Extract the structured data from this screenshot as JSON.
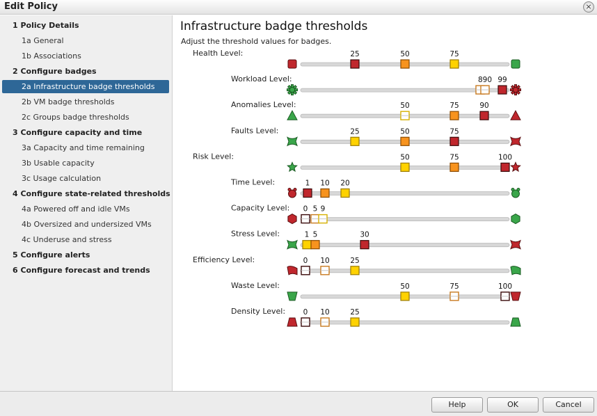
{
  "window": {
    "title": "Edit Policy"
  },
  "nav": [
    {
      "label": "1 Policy Details",
      "type": "section"
    },
    {
      "label": "1a General",
      "type": "sub"
    },
    {
      "label": "1b Associations",
      "type": "sub"
    },
    {
      "label": "2 Configure badges",
      "type": "section"
    },
    {
      "label": "2a Infrastructure badge thresholds",
      "type": "sub",
      "selected": true
    },
    {
      "label": "2b VM badge thresholds",
      "type": "sub"
    },
    {
      "label": "2c Groups badge thresholds",
      "type": "sub"
    },
    {
      "label": "3 Configure capacity and time",
      "type": "section"
    },
    {
      "label": "3a Capacity and time remaining",
      "type": "sub"
    },
    {
      "label": "3b Usable capacity",
      "type": "sub"
    },
    {
      "label": "3c Usage calculation",
      "type": "sub"
    },
    {
      "label": "4 Configure state-related thresholds",
      "type": "section"
    },
    {
      "label": "4a Powered off and idle VMs",
      "type": "sub"
    },
    {
      "label": "4b Oversized and undersized VMs",
      "type": "sub"
    },
    {
      "label": "4c Underuse and stress",
      "type": "sub"
    },
    {
      "label": "5 Configure alerts",
      "type": "section"
    },
    {
      "label": "6 Configure forecast and trends",
      "type": "section"
    }
  ],
  "main": {
    "title": "Infrastructure badge thresholds",
    "description": "Adjust the threshold values for badges."
  },
  "colors": {
    "red": "#c0272d",
    "orange": "#f7931e",
    "yellow": "#ffd200",
    "green": "#3aa64a",
    "selected_nav": "#2e6797",
    "track": "#d8d8d8"
  },
  "thresholds": [
    {
      "label": "Health Level:",
      "level": 0,
      "left_icon": "red-square-icon",
      "right_icon": "green-square-icon",
      "handles": [
        {
          "value": "25",
          "color": "red"
        },
        {
          "value": "50",
          "color": "orange"
        },
        {
          "value": "75",
          "color": "yellow"
        }
      ]
    },
    {
      "label": "Workload Level:",
      "level": 1,
      "left_icon": "green-gear-icon",
      "right_icon": "red-gear-icon",
      "handles": [
        {
          "value": "",
          "color": "disabled-orange"
        },
        {
          "value": "890",
          "color": "disabled-orange"
        },
        {
          "value": "99",
          "color": "red"
        }
      ]
    },
    {
      "label": "Anomalies Level:",
      "level": 1,
      "left_icon": "green-triangle-icon",
      "right_icon": "red-triangle-icon",
      "handles": [
        {
          "value": "50",
          "color": "disabled-yellow"
        },
        {
          "value": "75",
          "color": "orange"
        },
        {
          "value": "90",
          "color": "red"
        }
      ]
    },
    {
      "label": "Faults Level:",
      "level": 1,
      "left_icon": "green-bowtie-icon",
      "right_icon": "red-bowtie-icon",
      "handles": [
        {
          "value": "25",
          "color": "yellow"
        },
        {
          "value": "50",
          "color": "orange"
        },
        {
          "value": "75",
          "color": "red"
        }
      ]
    },
    {
      "label": "Risk Level:",
      "level": 0,
      "left_icon": "green-star-icon",
      "right_icon": "red-star-icon",
      "handles": [
        {
          "value": "50",
          "color": "yellow"
        },
        {
          "value": "75",
          "color": "orange"
        },
        {
          "value": "100",
          "color": "red"
        }
      ]
    },
    {
      "label": "Time Level:",
      "level": 1,
      "left_icon": "red-clock-icon",
      "right_icon": "green-clock-icon",
      "handles": [
        {
          "value": "1",
          "color": "red"
        },
        {
          "value": "10",
          "color": "orange"
        },
        {
          "value": "20",
          "color": "yellow"
        }
      ]
    },
    {
      "label": "Capacity Level:",
      "level": 1,
      "left_icon": "red-hexagon-icon",
      "right_icon": "green-hexagon-icon",
      "handles": [
        {
          "value": "0",
          "color": "disabled-red"
        },
        {
          "value": "5",
          "color": "disabled-orange"
        },
        {
          "value": "9",
          "color": "disabled-yellow"
        }
      ]
    },
    {
      "label": "Stress Level:",
      "level": 1,
      "left_icon": "green-bowtie-icon",
      "right_icon": "red-bowtie-icon",
      "handles": [
        {
          "value": "1",
          "color": "yellow"
        },
        {
          "value": "5",
          "color": "orange"
        },
        {
          "value": "30",
          "color": "red"
        }
      ]
    },
    {
      "label": "Efficiency Level:",
      "level": 0,
      "left_icon": "red-ribbon-icon",
      "right_icon": "green-ribbon-icon",
      "handles": [
        {
          "value": "0",
          "color": "disabled-red"
        },
        {
          "value": "10",
          "color": "disabled-orange"
        },
        {
          "value": "25",
          "color": "yellow"
        }
      ]
    },
    {
      "label": "Waste Level:",
      "level": 1,
      "left_icon": "green-cup-icon",
      "right_icon": "red-cup-icon",
      "handles": [
        {
          "value": "50",
          "color": "yellow"
        },
        {
          "value": "75",
          "color": "disabled-orange"
        },
        {
          "value": "100",
          "color": "disabled-red"
        }
      ]
    },
    {
      "label": "Density Level:",
      "level": 1,
      "left_icon": "red-trapezoid-icon",
      "right_icon": "green-trapezoid-icon",
      "handles": [
        {
          "value": "0",
          "color": "disabled-red"
        },
        {
          "value": "10",
          "color": "disabled-orange"
        },
        {
          "value": "25",
          "color": "yellow"
        }
      ]
    }
  ],
  "footer": {
    "help_label": "Help",
    "ok_label": "OK",
    "cancel_label": "Cancel"
  }
}
